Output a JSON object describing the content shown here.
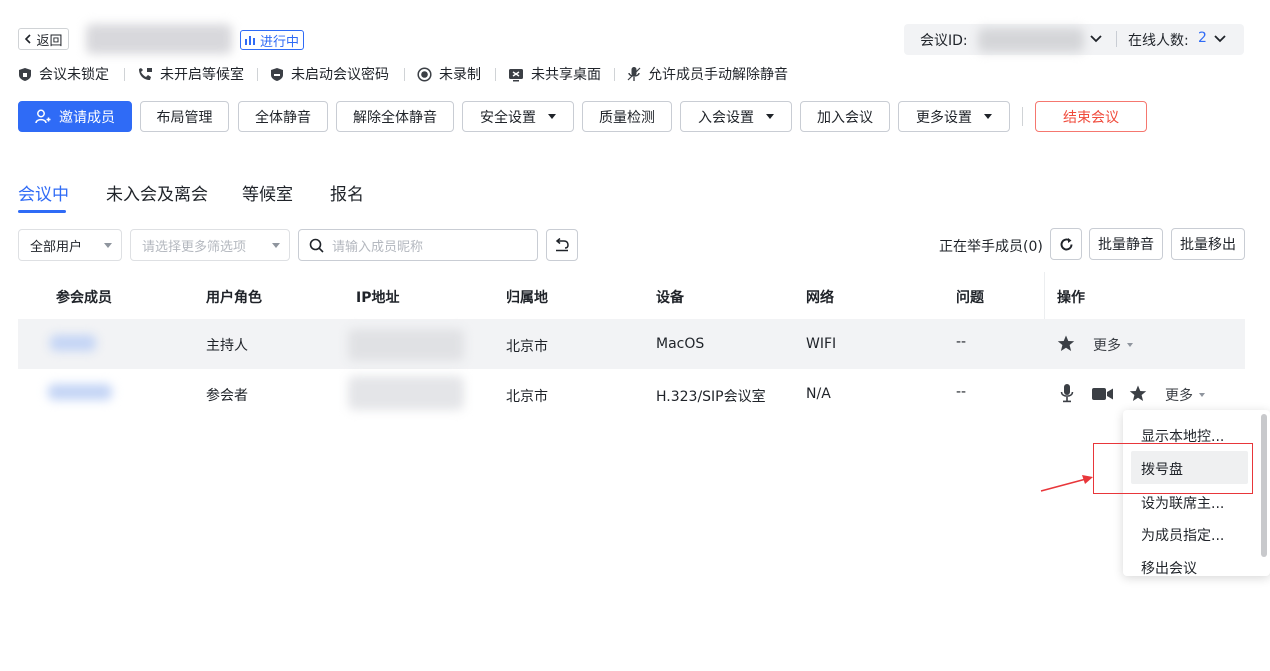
{
  "header": {
    "back_label": "返回",
    "status_badge": "进行中",
    "meeting_id_label": "会议ID:",
    "online_label": "在线人数:",
    "online_count": "2"
  },
  "status_bar": [
    {
      "icon": "shield-icon",
      "label": "会议未锁定"
    },
    {
      "icon": "phone-icon",
      "label": "未开启等候室"
    },
    {
      "icon": "shield-fill-icon",
      "label": "未启动会议密码"
    },
    {
      "icon": "record-icon",
      "label": "未录制"
    },
    {
      "icon": "screen-share-icon",
      "label": "未共享桌面"
    },
    {
      "icon": "mic-icon",
      "label": "允许成员手动解除静音"
    }
  ],
  "toolbar": {
    "invite": "邀请成员",
    "layout": "布局管理",
    "mute_all": "全体静音",
    "unmute_all": "解除全体静音",
    "security": "安全设置",
    "quality": "质量检测",
    "join_settings": "入会设置",
    "join_meeting": "加入会议",
    "more_settings": "更多设置",
    "end_meeting": "结束会议"
  },
  "tabs": [
    "会议中",
    "未入会及离会",
    "等候室",
    "报名"
  ],
  "filters": {
    "user_select": "全部用户",
    "more_filter_placeholder": "请选择更多筛选项",
    "search_placeholder": "请输入成员昵称",
    "raise_hand": "正在举手成员(0)",
    "batch_mute": "批量静音",
    "batch_remove": "批量移出"
  },
  "table": {
    "columns": [
      "参会成员",
      "用户角色",
      "IP地址",
      "归属地",
      "设备",
      "网络",
      "问题",
      "操作"
    ],
    "rows": [
      {
        "role": "主持人",
        "location": "北京市",
        "device": "MacOS",
        "network": "WIFI",
        "issue": "--",
        "more": "更多"
      },
      {
        "role": "参会者",
        "location": "北京市",
        "device": "H.323/SIP会议室",
        "network": "N/A",
        "issue": "--",
        "more": "更多"
      }
    ]
  },
  "dropdown_menu": [
    "显示本地控...",
    "拨号盘",
    "设为联席主...",
    "为成员指定...",
    "移出会议"
  ],
  "colors": {
    "accent": "#2f6bf6",
    "danger": "#f04b3c",
    "highlight_box": "#e8363a"
  }
}
